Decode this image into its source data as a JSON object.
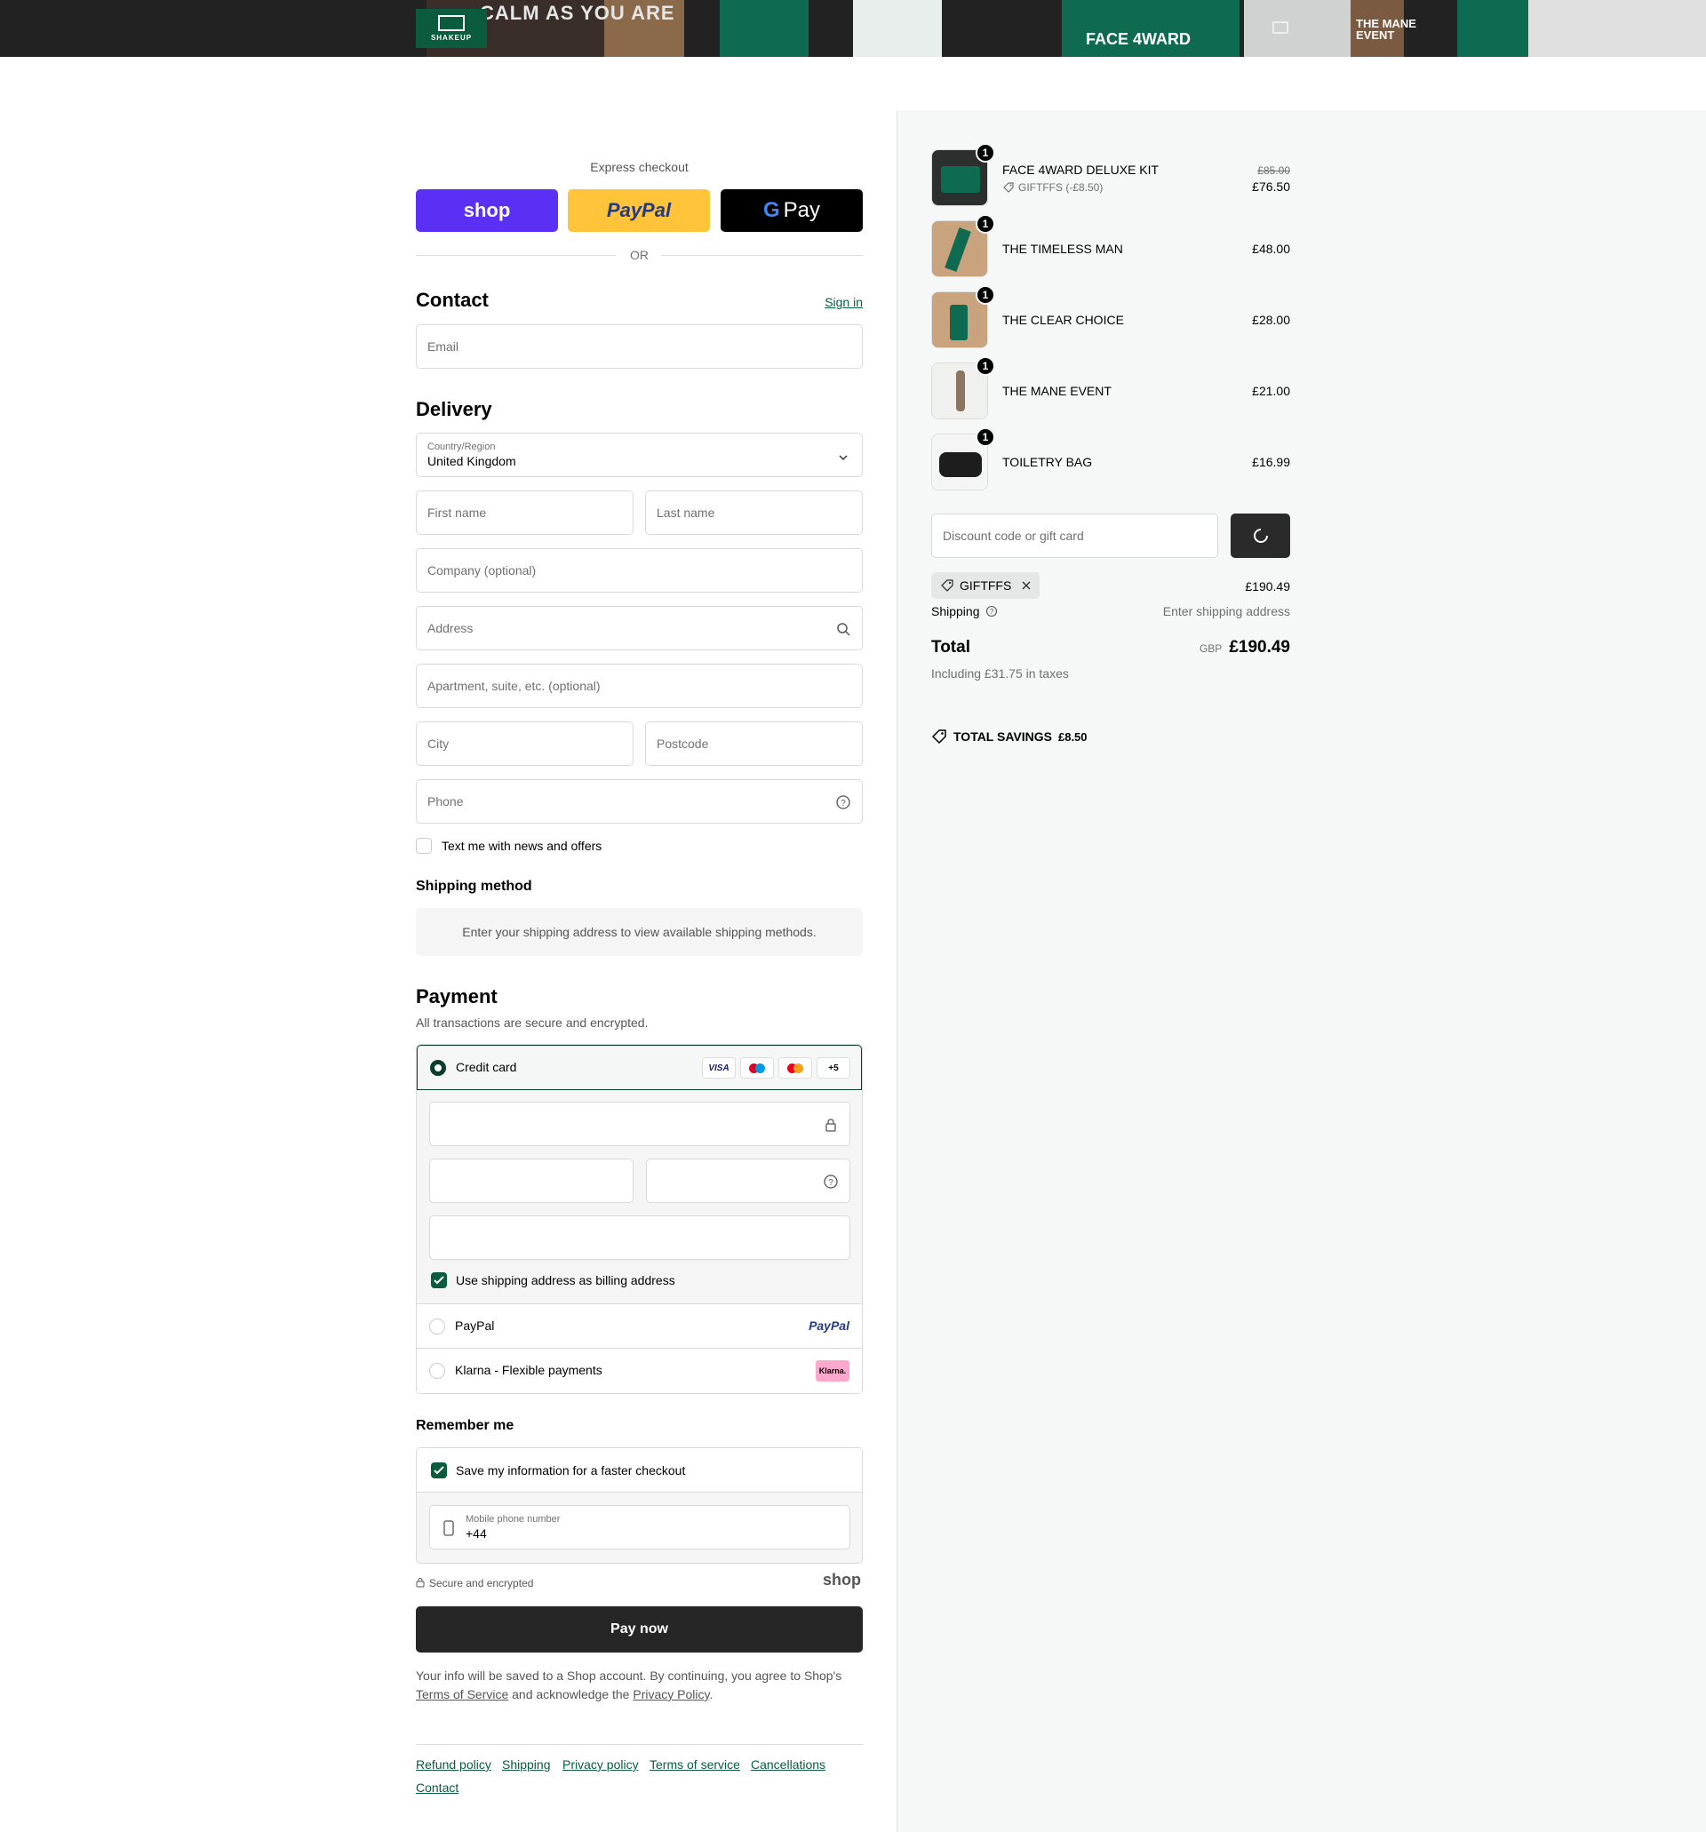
{
  "banner": {
    "brand": "SHAKEUP",
    "product_texts": [
      "CALM AS YOU ARE",
      "FACE 4WARD",
      "THE MANE EVENT"
    ]
  },
  "express": {
    "label": "Express checkout",
    "shop_label": "shop",
    "paypal_label": "PayPal",
    "gpay_label": "Pay",
    "or_label": "OR"
  },
  "contact": {
    "heading": "Contact",
    "sign_in": "Sign in",
    "email_placeholder": "Email"
  },
  "delivery": {
    "heading": "Delivery",
    "country_label": "Country/Region",
    "country_value": "United Kingdom",
    "first_name": "First name",
    "last_name": "Last name",
    "company": "Company (optional)",
    "address": "Address",
    "apartment": "Apartment, suite, etc. (optional)",
    "city": "City",
    "postcode": "Postcode",
    "phone": "Phone",
    "text_offers": "Text me with news and offers"
  },
  "shipping_method": {
    "heading": "Shipping method",
    "message": "Enter your shipping address to view available shipping methods."
  },
  "payment": {
    "heading": "Payment",
    "subtitle": "All transactions are secure and encrypted.",
    "credit_card": "Credit card",
    "cards": [
      "VISA",
      "Maestro",
      "Mastercard",
      "+5"
    ],
    "billing_same": "Use shipping address as billing address",
    "paypal": "PayPal",
    "paypal_logo": "PayPal",
    "klarna": "Klarna - Flexible payments",
    "klarna_logo": "Klarna."
  },
  "remember": {
    "heading": "Remember me",
    "save_info": "Save my information for a faster checkout",
    "mobile_label": "Mobile phone number",
    "mobile_value": "+44",
    "secure": "Secure and encrypted",
    "shop_logo": "shop"
  },
  "pay_now": "Pay now",
  "legal": {
    "line1": "Your info will be saved to a Shop account. By continuing, you agree to Shop's",
    "terms": "Terms of Service",
    "mid": "and acknowledge the",
    "privacy": "Privacy Policy",
    "end": "."
  },
  "footer_links": [
    "Refund policy",
    "Shipping",
    "Privacy policy",
    "Terms of service",
    "Cancellations",
    "Contact"
  ],
  "summary": {
    "items": [
      {
        "name": "FACE 4WARD DELUXE KIT",
        "qty": "1",
        "original_price": "£85.00",
        "price": "£76.50",
        "discount": "GIFTFFS (-£8.50)"
      },
      {
        "name": "THE TIMELESS MAN",
        "qty": "1",
        "price": "£48.00"
      },
      {
        "name": "THE CLEAR CHOICE",
        "qty": "1",
        "price": "£28.00"
      },
      {
        "name": "THE MANE EVENT",
        "qty": "1",
        "price": "£21.00"
      },
      {
        "name": "TOILETRY BAG",
        "qty": "1",
        "price": "£16.99"
      }
    ],
    "discount_placeholder": "Discount code or gift card",
    "applied_code": "GIFTFFS",
    "subtotal": "£190.49",
    "shipping_label": "Shipping",
    "shipping_value": "Enter shipping address",
    "total_label": "Total",
    "currency": "GBP",
    "total": "£190.49",
    "taxes": "Including £31.75 in taxes",
    "savings_label": "TOTAL SAVINGS",
    "savings_value": "£8.50"
  },
  "colors": {
    "accent": "#0b5b3f",
    "shop_purple": "#5a31f4",
    "paypal_yellow": "#ffc439",
    "pay_button": "#262626"
  }
}
